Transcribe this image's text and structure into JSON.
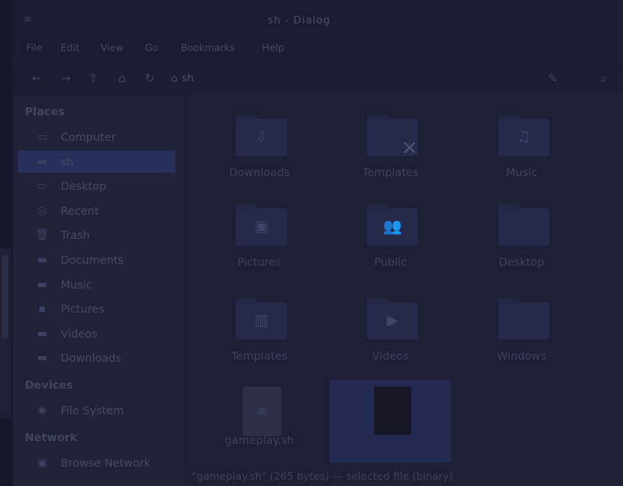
{
  "window": {
    "title": "sh - Dialog",
    "app_menu": "≡"
  },
  "menubar": [
    "File",
    "Edit",
    "View",
    "Go",
    "Bookmarks",
    "Help"
  ],
  "toolbar": {
    "back_icon": "back-arrow-icon",
    "forward_icon": "forward-arrow-icon",
    "up_icon": "up-arrow-icon",
    "home_icon": "home-icon",
    "reload_icon": "reload-icon",
    "path_icon": "⌂",
    "path": "sh",
    "edit_icon": "pencil-icon",
    "search_icon": "search-icon"
  },
  "sidebar": {
    "places_header": "Places",
    "places": [
      {
        "label": "Computer",
        "icon": "computer-icon",
        "glyph": "▭"
      },
      {
        "label": "sh",
        "icon": "home-folder-icon",
        "glyph": "▬",
        "active": true
      },
      {
        "label": "Desktop",
        "icon": "desktop-icon",
        "glyph": "▭"
      },
      {
        "label": "Recent",
        "icon": "recent-icon",
        "glyph": "◎"
      },
      {
        "label": "Trash",
        "icon": "trash-icon",
        "glyph": "🗑"
      },
      {
        "label": "Documents",
        "icon": "documents-icon",
        "glyph": "▬"
      },
      {
        "label": "Music",
        "icon": "music-icon",
        "glyph": "▬"
      },
      {
        "label": "Pictures",
        "icon": "pictures-icon",
        "glyph": "▪"
      },
      {
        "label": "Videos",
        "icon": "videos-icon",
        "glyph": "▬"
      },
      {
        "label": "Downloads",
        "icon": "downloads-icon",
        "glyph": "▬"
      }
    ],
    "devices_header": "Devices",
    "devices": [
      {
        "label": "File System",
        "icon": "drive-icon",
        "glyph": "◉"
      }
    ],
    "network_header": "Network",
    "network": [
      {
        "label": "Browse Network",
        "icon": "network-icon",
        "glyph": "▣"
      }
    ]
  },
  "files": [
    {
      "name": "Downloads",
      "icon": "downloads-folder-icon",
      "glyph": "⇩"
    },
    {
      "name": "Templates",
      "icon": "folder-icon",
      "glyph": ""
    },
    {
      "name": "Music",
      "icon": "music-folder-icon",
      "glyph": "♫"
    },
    {
      "name": "Pictures",
      "icon": "pictures-folder-icon",
      "glyph": "▣"
    },
    {
      "name": "Public",
      "icon": "public-folder-icon",
      "glyph": "👥"
    },
    {
      "name": "Desktop",
      "icon": "desktop-folder-icon",
      "glyph": ""
    },
    {
      "name": "Templates",
      "icon": "templates-folder-icon",
      "glyph": "▥"
    },
    {
      "name": "Videos",
      "icon": "videos-folder-icon",
      "glyph": "▶"
    },
    {
      "name": "Windows",
      "icon": "folder-icon",
      "glyph": ""
    },
    {
      "name": "gameplay.sh",
      "icon": "text-file-icon",
      "glyph": "≡"
    },
    {
      "name": "",
      "icon": "dark-file-icon",
      "glyph": "",
      "selected": true
    }
  ],
  "close_glyph": "✕",
  "status": "\"gameplay.sh\" (265 bytes) — selected file (binary)"
}
